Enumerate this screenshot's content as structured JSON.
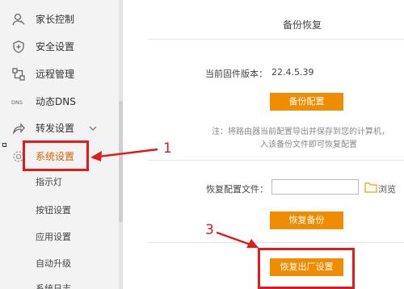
{
  "sidebar": {
    "items": [
      {
        "label": "家长控制",
        "icon": "parental-control-icon"
      },
      {
        "label": "安全设置",
        "icon": "shield-icon"
      },
      {
        "label": "远程管理",
        "icon": "remote-management-icon"
      },
      {
        "label": "动态DNS",
        "icon": "dns-icon"
      },
      {
        "label": "转发设置",
        "icon": "forward-icon"
      },
      {
        "label": "系统设置",
        "icon": "gear-icon"
      }
    ],
    "sub_items": [
      "指示灯",
      "按钮设置",
      "应用设置",
      "自动升级",
      "系统日志"
    ]
  },
  "main": {
    "title": "备份恢复",
    "firmware_label": "当前固件版本：",
    "firmware_version": "22.4.5.39",
    "backup_button": "备份配置",
    "note_line1": "注：将路由器当前配置导出并保存到您的计算机，",
    "note_line2": "入该备份文件即可恢复配置",
    "restore_file_label": "恢复配置文件：",
    "browse_label": "浏览",
    "restore_button": "恢复备份",
    "factory_reset_button": "恢复出厂设置"
  },
  "annotations": {
    "one": "1",
    "three": "3",
    "color": "#e01b1b"
  },
  "colors": {
    "accent": "#f08c00",
    "sidebar_bg": "#f3f3f3"
  }
}
